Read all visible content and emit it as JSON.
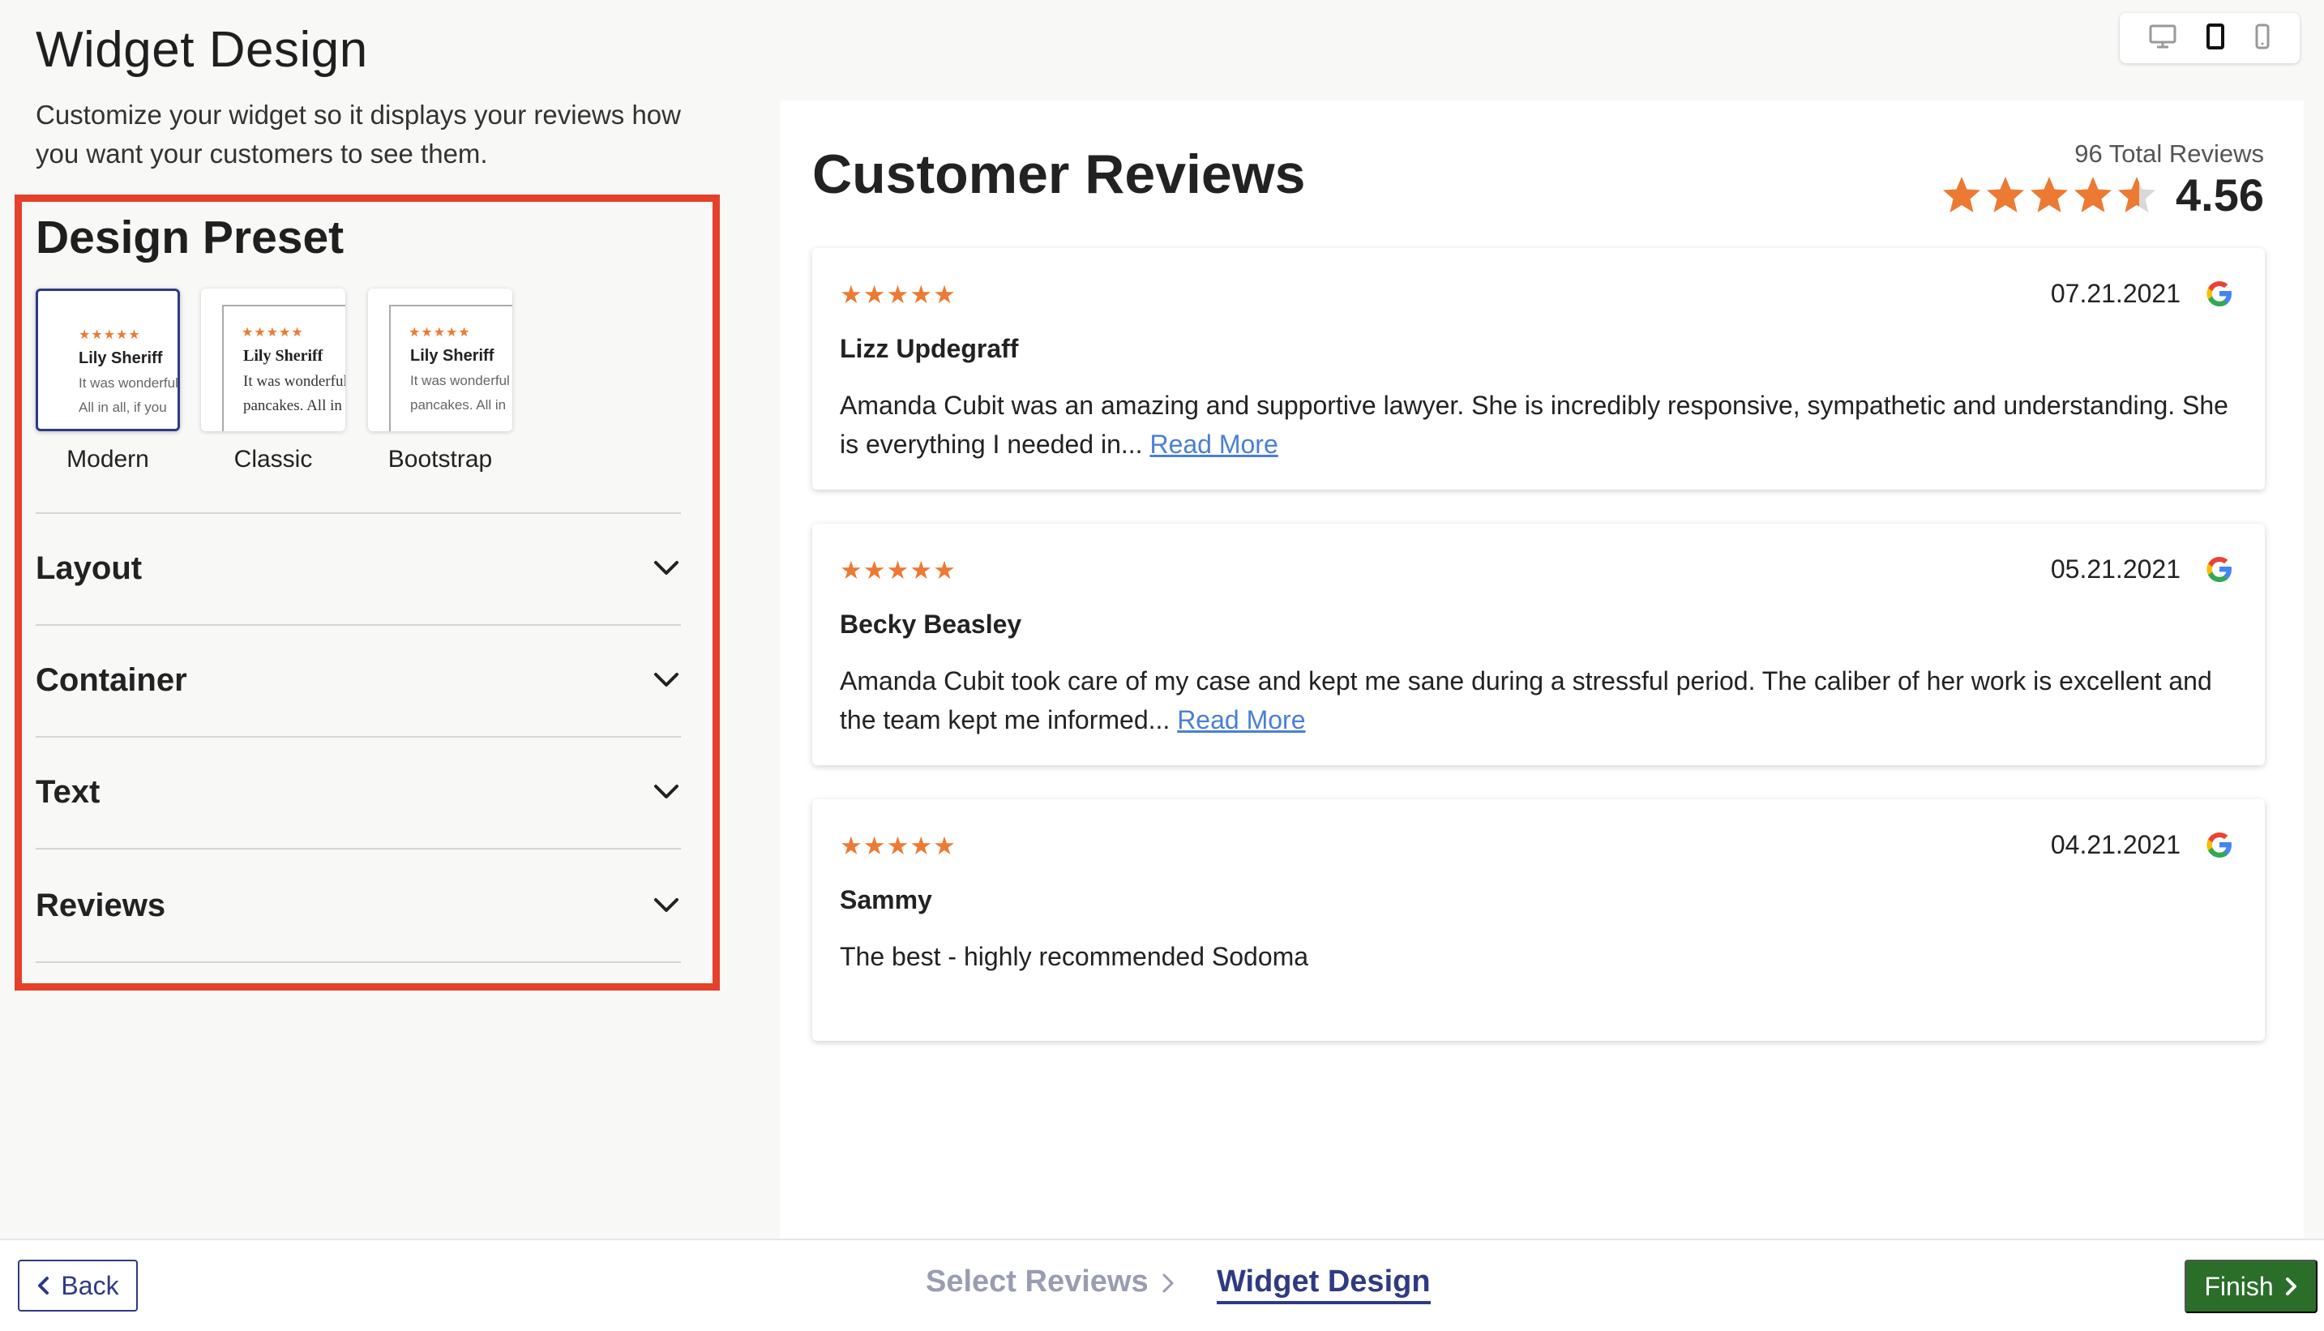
{
  "header": {
    "title": "Widget Design",
    "subtitle": "Customize your widget so it displays your reviews how you want your customers to see them."
  },
  "design_preset": {
    "title": "Design Preset",
    "presets": [
      {
        "label": "Modern",
        "name": "Lily Sheriff",
        "line1": "It was wonderful",
        "line2": "All in all, if you",
        "selected": true
      },
      {
        "label": "Classic",
        "name": "Lily Sheriff",
        "line1": "It was wonderful",
        "line2": "pancakes. All in",
        "selected": false
      },
      {
        "label": "Bootstrap",
        "name": "Lily Sheriff",
        "line1": "It was wonderful",
        "line2": "pancakes. All in",
        "selected": false
      }
    ],
    "preset_stars": "★★★★★"
  },
  "accordion": [
    {
      "label": "Layout"
    },
    {
      "label": "Container"
    },
    {
      "label": "Text"
    },
    {
      "label": "Reviews"
    }
  ],
  "preview": {
    "title": "Customer Reviews",
    "total_reviews": "96 Total Reviews",
    "rating": "4.56",
    "rating_value": 4.56,
    "star_color": "#ec7a33",
    "reviews": [
      {
        "stars": "★★★★★",
        "date": "07.21.2021",
        "author": "Lizz Updegraff",
        "body": "Amanda Cubit was an amazing and supportive lawyer. She is incredibly responsive, sympathetic and understanding. She is everything I needed in...",
        "read_more": "Read More",
        "source_icon": "google-icon"
      },
      {
        "stars": "★★★★★",
        "date": "05.21.2021",
        "author": "Becky Beasley",
        "body": "Amanda Cubit took care of my case and kept me sane during a stressful period. The caliber of her work is excellent and the team kept me informed...",
        "read_more": "Read More",
        "source_icon": "google-icon"
      },
      {
        "stars": "★★★★★",
        "date": "04.21.2021",
        "author": "Sammy",
        "body": "The best - highly recommended Sodoma",
        "read_more": "",
        "source_icon": "google-icon"
      }
    ]
  },
  "device_toggle": {
    "options": [
      "desktop-icon",
      "tablet-icon",
      "mobile-icon"
    ],
    "active": "tablet-icon"
  },
  "footer": {
    "back_label": "Back",
    "steps": [
      "Select Reviews",
      "Widget Design"
    ],
    "active_step": "Widget Design",
    "finish_label": "Finish",
    "colors": {
      "primary": "#2f3a84",
      "finish": "#2a6e2a",
      "highlight": "#e5402a",
      "link": "#4a7fd6"
    }
  }
}
